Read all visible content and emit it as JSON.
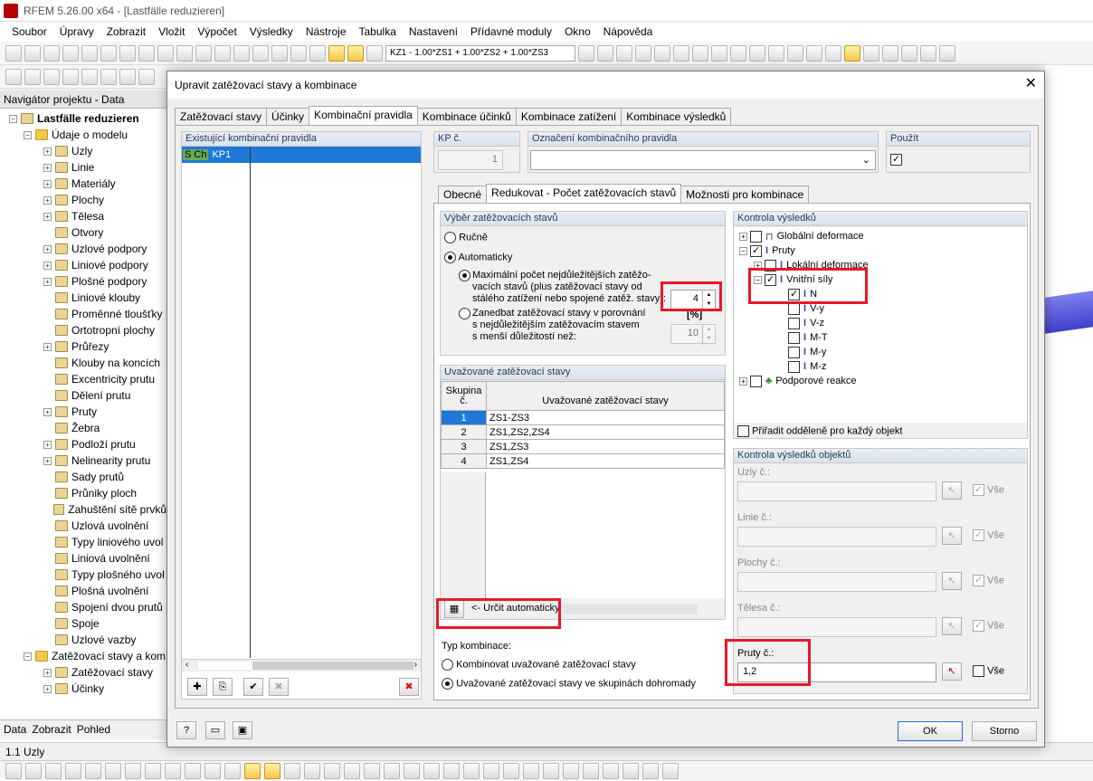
{
  "app": {
    "title": "RFEM 5.26.00 x64 - [Lastfälle reduzieren]",
    "menu": [
      "Soubor",
      "Úpravy",
      "Zobrazit",
      "Vložit",
      "Výpočet",
      "Výsledky",
      "Nástroje",
      "Tabulka",
      "Nastavení",
      "Přídavné moduly",
      "Okno",
      "Nápověda"
    ],
    "combo": "KZ1 - 1.00*ZS1 + 1.00*ZS2 + 1.00*ZS3"
  },
  "navigator": {
    "header": "Navigátor projektu - Data",
    "root": "Lastfälle reduzieren",
    "model_group": "Údaje o modelu",
    "items": [
      "Uzly",
      "Linie",
      "Materiály",
      "Plochy",
      "Tělesa",
      "Otvory",
      "Uzlové podpory",
      "Liniové podpory",
      "Plošné podpory",
      "Liniové klouby",
      "Proměnné tloušťky",
      "Ortotropní plochy",
      "Průřezy",
      "Klouby na koncích",
      "Excentricity prutu",
      "Dělení prutu",
      "Pruty",
      "Žebra",
      "Podloží prutu",
      "Nelinearity prutu",
      "Sady prutů",
      "Průniky ploch",
      "Zahuštění sítě prvků",
      "Uzlová uvolnění",
      "Typy liniového uvol",
      "Liniová uvolnění",
      "Typy plošného uvol",
      "Plošná uvolnění",
      "Spojení dvou prutů",
      "Spoje",
      "Uzlové vazby"
    ],
    "load_group": "Zatěžovací stavy a kom",
    "load_items": [
      "Zatěžovací stavy",
      "Účinky"
    ],
    "tabs": [
      "Data",
      "Zobrazit",
      "Pohled"
    ]
  },
  "status": "1.1 Uzly",
  "dialog": {
    "title": "Upravit zatěžovací stavy a kombinace",
    "close": "✕",
    "tabs": [
      "Zatěžovací stavy",
      "Účinky",
      "Kombinační pravidla",
      "Kombinace účinků",
      "Kombinace zatížení",
      "Kombinace výsledků"
    ],
    "existing_header": "Existující kombinační pravidla",
    "existing_rule": {
      "badge": "S Ch",
      "name": "KP1"
    },
    "kp_label": "KP č.",
    "kp_value": "1",
    "designation_label": "Označení kombinačního pravidla",
    "designation_value": "",
    "use_label": "Použít",
    "subtabs": [
      "Obecné",
      "Redukovat - Počet zatěžovacích stavů",
      "Možnosti pro kombinace"
    ],
    "selection": {
      "header": "Výběr zatěžovacích stavů",
      "manual": "Ručně",
      "auto": "Automaticky",
      "max_text_1": "Maximální počet nejdůležitějších zatěžo-",
      "max_text_2": "vacích stavů (plus zatěžovací stavy od",
      "max_text_3": "stálého zatížení nebo spojené zatěž. stavy):",
      "max_value": "4",
      "neglect_text_1": "Zanedbat zatěžovací stavy v porovnání",
      "neglect_text_2": "s nejdůležitějším zatěžovacím stavem",
      "neglect_text_3": "s menší důležitostí než:",
      "percent_unit": "[%]",
      "neglect_value": "10"
    },
    "considered": {
      "header": "Uvažované zatěžovací stavy",
      "col_group": "Skupina č.",
      "col_cases": "Uvažované zatěžovací stavy",
      "rows": [
        {
          "group": "1",
          "cases": "ZS1-ZS3"
        },
        {
          "group": "2",
          "cases": "ZS1,ZS2,ZS4"
        },
        {
          "group": "3",
          "cases": "ZS1,ZS3"
        },
        {
          "group": "4",
          "cases": "ZS1,ZS4"
        }
      ],
      "auto_button": "<- Určit automaticky"
    },
    "combo_type": {
      "label": "Typ kombinace:",
      "option1": "Kombinovat uvažované zatěžovací stavy",
      "option2": "Uvažované zatěžovací stavy ve skupinách dohromady"
    },
    "results_check": {
      "header": "Kontrola výsledků",
      "global": "Globální deformace",
      "members": "Pruty",
      "local": "Lokální deformace",
      "internal": "Vnitřní síly",
      "forces": [
        "N",
        "V-y",
        "V-z",
        "M-T",
        "M-y",
        "M-z"
      ],
      "support": "Podporové reakce",
      "assign": "Přiřadit odděleně pro každý objekt"
    },
    "object_check": {
      "header": "Kontrola výsledků objektů",
      "nodes": "Uzly č.:",
      "lines": "Linie č.:",
      "surfaces": "Plochy č.:",
      "solids": "Tělesa č.:",
      "members": "Pruty č.:",
      "members_value": "1,2",
      "all": "Vše"
    },
    "ok": "OK",
    "cancel": "Storno"
  }
}
